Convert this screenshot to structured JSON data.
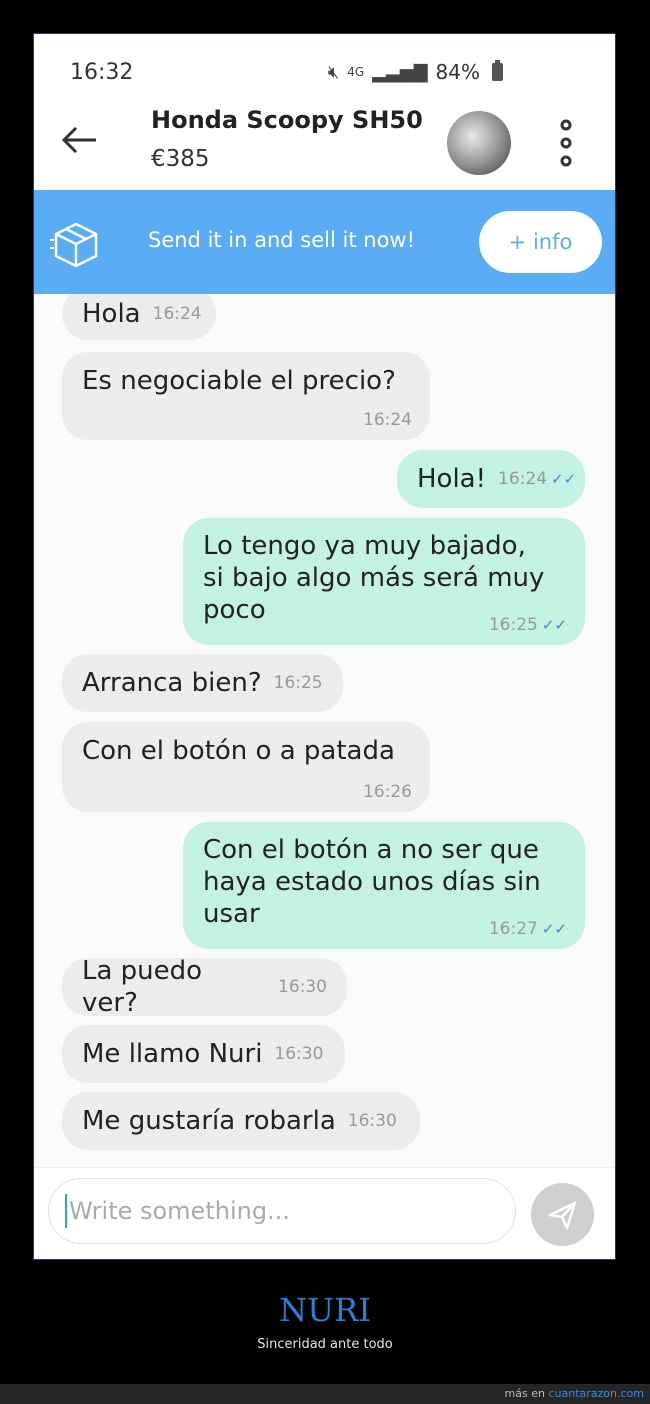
{
  "status_bar": {
    "time": "16:32",
    "network": "4G",
    "battery": "84%"
  },
  "header": {
    "title": "Honda Scoopy SH50",
    "price": "€385"
  },
  "banner": {
    "text": "Send it in and sell it now!",
    "button": "+ info"
  },
  "messages": [
    {
      "side": "in",
      "lines": [
        "Hola"
      ],
      "time": "16:24"
    },
    {
      "side": "in",
      "lines": [
        "Es negociable el precio?"
      ],
      "time": "16:24"
    },
    {
      "side": "out",
      "lines": [
        "Hola!"
      ],
      "time": "16:24",
      "read": true
    },
    {
      "side": "out",
      "lines": [
        "Lo tengo ya muy bajado,",
        "si bajo algo más será muy",
        "poco"
      ],
      "time": "16:25",
      "read": true
    },
    {
      "side": "in",
      "lines": [
        "Arranca bien?"
      ],
      "time": "16:25"
    },
    {
      "side": "in",
      "lines": [
        "Con el botón o a patada"
      ],
      "time": "16:26"
    },
    {
      "side": "out",
      "lines": [
        "Con el botón a no ser que",
        "haya estado unos días sin",
        "usar"
      ],
      "time": "16:27",
      "read": true
    },
    {
      "side": "in",
      "lines": [
        "La puedo ver?"
      ],
      "time": "16:30"
    },
    {
      "side": "in",
      "lines": [
        "Me llamo Nuri"
      ],
      "time": "16:30"
    },
    {
      "side": "in",
      "lines": [
        "Me gustaría robarla"
      ],
      "time": "16:30"
    }
  ],
  "composer": {
    "placeholder": "Write something..."
  },
  "caption": {
    "title": "NURI",
    "subtitle": "Sinceridad ante todo"
  },
  "footer": {
    "prefix": "más en",
    "site": "cuantarazon.com"
  },
  "colors": {
    "banner": "#5aacf5",
    "outgoing_bubble": "#c3f2e2",
    "incoming_bubble": "#ececec",
    "caption_title": "#2a7fd4"
  },
  "icons": [
    "muted-icon",
    "signal-icon",
    "battery-icon",
    "back-arrow-icon",
    "box-icon",
    "kebab-menu-icon",
    "read-ticks-icon",
    "send-icon"
  ]
}
